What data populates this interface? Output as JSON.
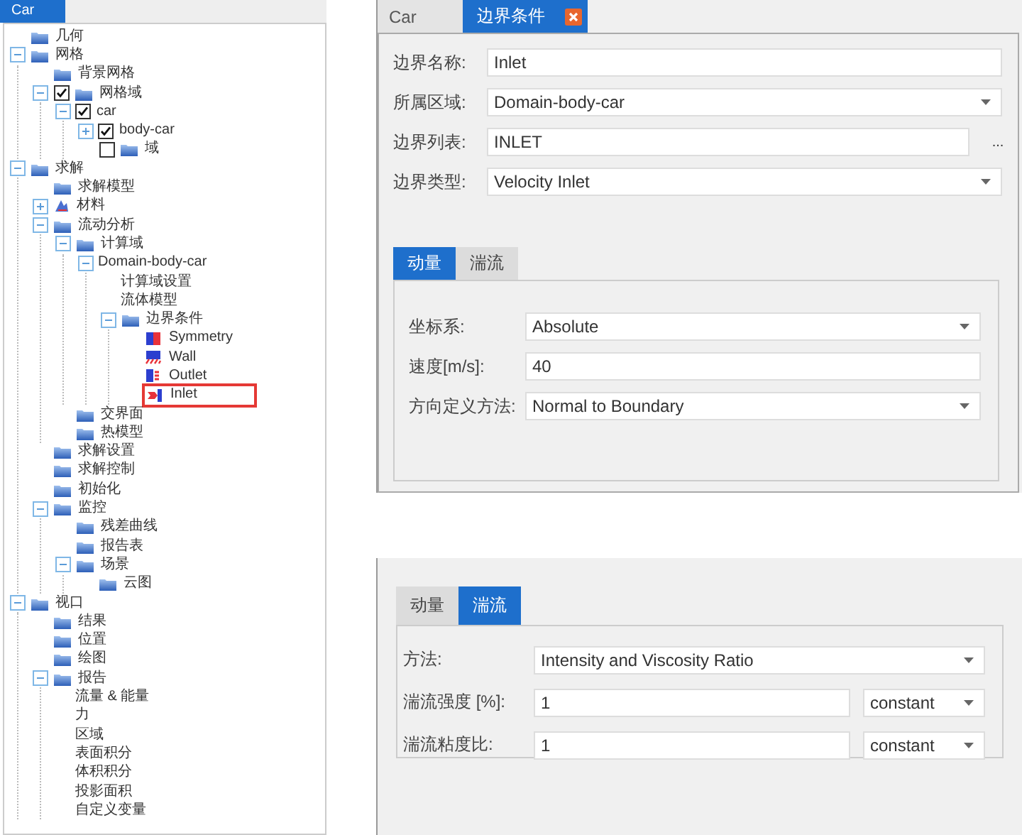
{
  "tree_tab": {
    "label": "Car"
  },
  "tree": [
    {
      "label": "几何",
      "kind": "folder"
    },
    {
      "label": "网格",
      "kind": "folder",
      "expanded": true,
      "children": [
        {
          "label": "背景网格",
          "kind": "folder"
        },
        {
          "label": "网格域",
          "kind": "folder",
          "expanded": true,
          "checked": true,
          "children": [
            {
              "label": "car",
              "kind": "none",
              "expanded": true,
              "checked": true,
              "children": [
                {
                  "label": "body-car",
                  "kind": "none",
                  "expanded": false,
                  "checked": true
                },
                {
                  "label": "域",
                  "kind": "folder",
                  "checked": false
                }
              ]
            }
          ]
        }
      ]
    },
    {
      "label": "求解",
      "kind": "folder",
      "expanded": true,
      "children": [
        {
          "label": "求解模型",
          "kind": "folder"
        },
        {
          "label": "材料",
          "kind": "material",
          "expanded": false
        },
        {
          "label": "流动分析",
          "kind": "folder",
          "expanded": true,
          "children": [
            {
              "label": "计算域",
              "kind": "folder",
              "expanded": true,
              "children": [
                {
                  "label": "Domain-body-car",
                  "kind": "none",
                  "expanded": true,
                  "children": [
                    {
                      "label": "计算域设置",
                      "kind": "none"
                    },
                    {
                      "label": "流体模型",
                      "kind": "none"
                    },
                    {
                      "label": "边界条件",
                      "kind": "folder",
                      "expanded": true,
                      "children": [
                        {
                          "label": "Symmetry",
                          "kind": "symmetry",
                          "highlighted": false
                        },
                        {
                          "label": "Wall",
                          "kind": "wall",
                          "highlighted": false
                        },
                        {
                          "label": "Outlet",
                          "kind": "outlet",
                          "highlighted": false
                        },
                        {
                          "label": "Inlet",
                          "kind": "inlet",
                          "highlighted": true
                        }
                      ]
                    }
                  ]
                }
              ]
            },
            {
              "label": "交界面",
              "kind": "folder"
            },
            {
              "label": "热模型",
              "kind": "folder"
            }
          ]
        },
        {
          "label": "求解设置",
          "kind": "folder"
        },
        {
          "label": "求解控制",
          "kind": "folder"
        },
        {
          "label": "初始化",
          "kind": "folder"
        },
        {
          "label": "监控",
          "kind": "folder",
          "expanded": true,
          "children": [
            {
              "label": "残差曲线",
              "kind": "folder"
            },
            {
              "label": "报告表",
              "kind": "folder"
            },
            {
              "label": "场景",
              "kind": "folder",
              "expanded": true,
              "children": [
                {
                  "label": "云图",
                  "kind": "folder"
                }
              ]
            }
          ]
        }
      ]
    },
    {
      "label": "视口",
      "kind": "folder",
      "expanded": true,
      "children": [
        {
          "label": "结果",
          "kind": "folder"
        },
        {
          "label": "位置",
          "kind": "folder"
        },
        {
          "label": "绘图",
          "kind": "folder"
        },
        {
          "label": "报告",
          "kind": "folder",
          "expanded": true,
          "children": [
            {
              "label": "流量 & 能量",
              "kind": "none"
            },
            {
              "label": "力",
              "kind": "none"
            },
            {
              "label": "区域",
              "kind": "none"
            },
            {
              "label": "表面积分",
              "kind": "none"
            },
            {
              "label": "体积积分",
              "kind": "none"
            },
            {
              "label": "投影面积",
              "kind": "none"
            },
            {
              "label": "自定义变量",
              "kind": "none"
            }
          ]
        }
      ]
    }
  ],
  "editor": {
    "tabs": [
      {
        "label": "Car",
        "selected": false,
        "closable": false
      },
      {
        "label": "边界条件",
        "selected": true,
        "closable": true
      }
    ],
    "fields": [
      {
        "label": "边界名称:",
        "kind": "text",
        "value": "Inlet"
      },
      {
        "label": "所属区域:",
        "kind": "dropdown",
        "value": "Domain-body-car"
      },
      {
        "label": "边界列表:",
        "kind": "browse",
        "value": "INLET",
        "button": "..."
      },
      {
        "label": "边界类型:",
        "kind": "dropdown",
        "value": "Velocity Inlet"
      }
    ],
    "subtabs": [
      {
        "label": "动量",
        "selected": true
      },
      {
        "label": "湍流",
        "selected": false
      }
    ],
    "sub_fields": [
      {
        "label": "坐标系:",
        "kind": "dropdown",
        "value": "Absolute"
      },
      {
        "label": "速度[m/s]:",
        "kind": "text",
        "value": "40"
      },
      {
        "label": "方向定义方法:",
        "kind": "dropdown",
        "value": "Normal to Boundary"
      }
    ]
  },
  "turbulence_panel": {
    "subtabs": [
      {
        "label": "动量",
        "selected": false
      },
      {
        "label": "湍流",
        "selected": true
      }
    ],
    "fields": [
      {
        "label": "方法:",
        "kind": "dropdown",
        "value": "Intensity and Viscosity Ratio"
      },
      {
        "label": "湍流强度 [%]:",
        "kind": "value-unit",
        "value": "1",
        "unit": "constant"
      },
      {
        "label": "湍流粘度比:",
        "kind": "value-unit",
        "value": "1",
        "unit": "constant"
      }
    ]
  }
}
